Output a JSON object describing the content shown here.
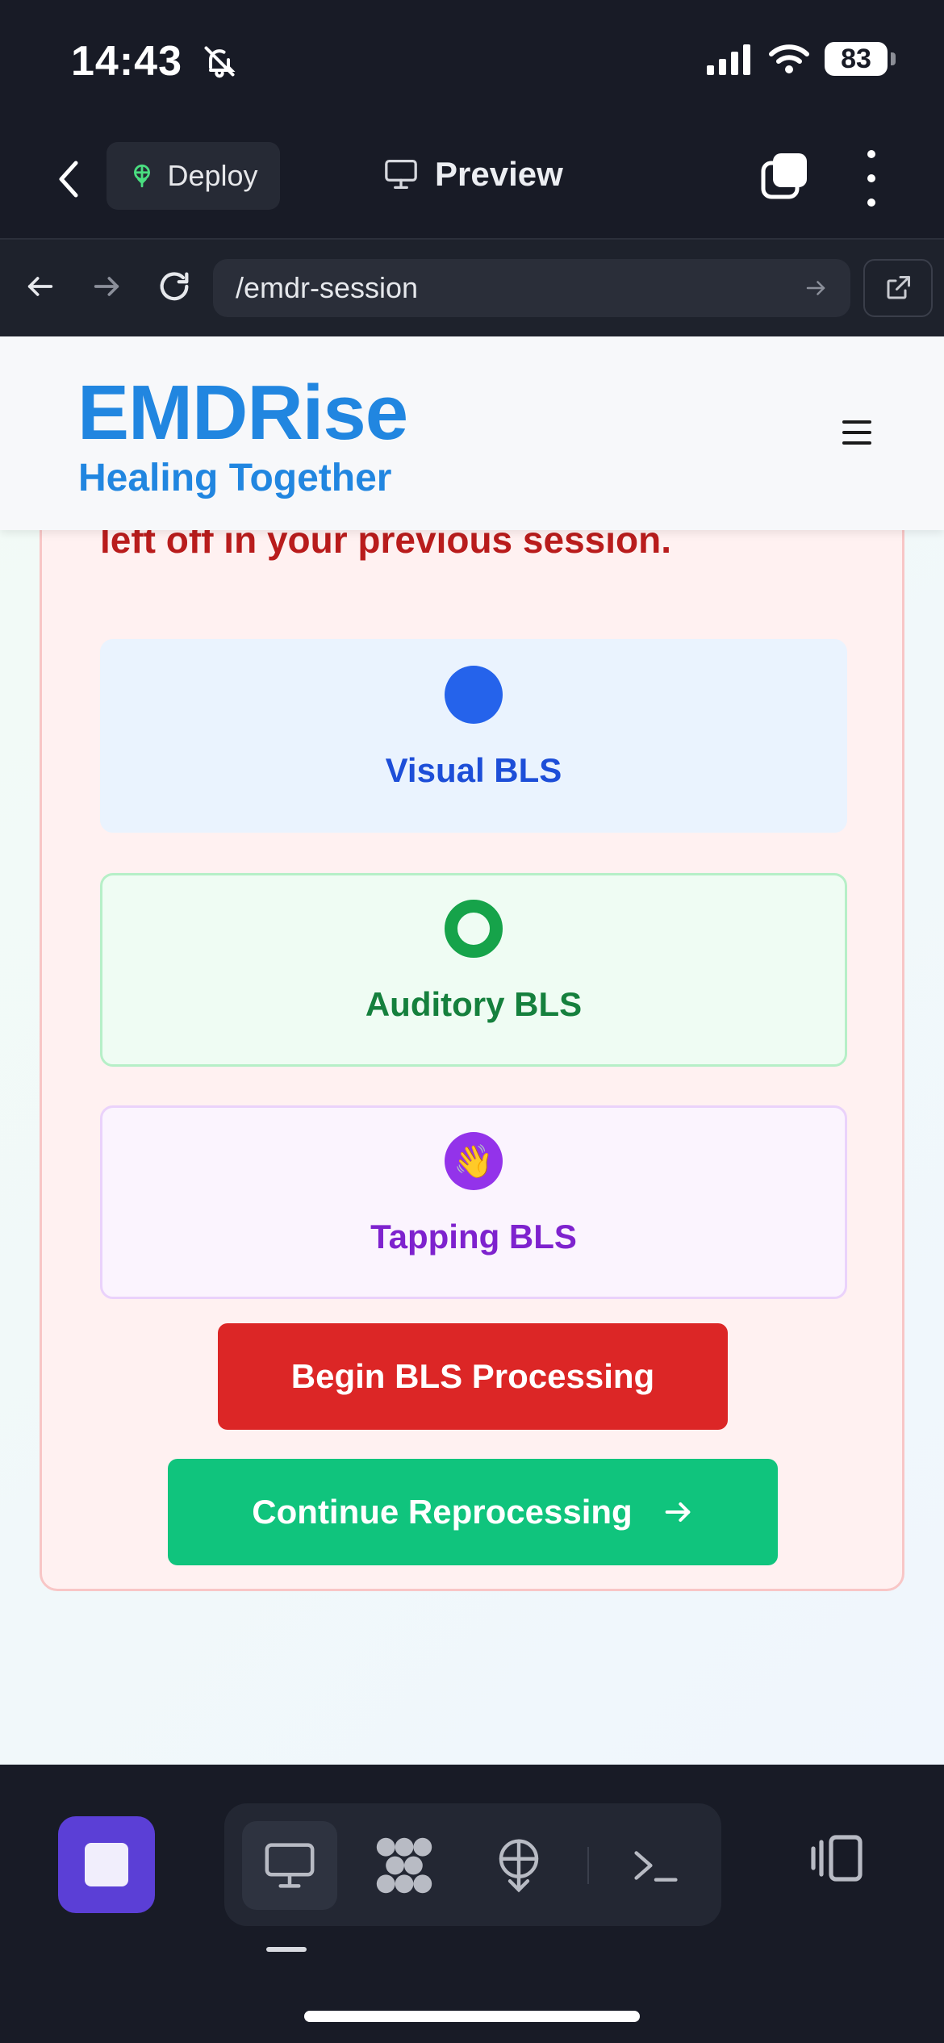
{
  "status_bar": {
    "time": "14:43",
    "battery": "83"
  },
  "toolbar": {
    "deploy_label": "Deploy",
    "preview_label": "Preview"
  },
  "browser": {
    "url": "/emdr-session"
  },
  "site": {
    "logo": "EMDRise",
    "tagline": "Healing Together"
  },
  "card": {
    "intro_text": "left off in your previous session.",
    "options": [
      {
        "label": "Visual BLS",
        "icon": "blue-dot-icon"
      },
      {
        "label": "Auditory BLS",
        "icon": "green-ring-icon"
      },
      {
        "label": "Tapping BLS",
        "icon": "waving-hand-icon",
        "emoji": "👋"
      }
    ],
    "begin_label": "Begin BLS Processing",
    "continue_label": "Continue Reprocessing",
    "continue_arrow": "→"
  },
  "colors": {
    "brand": "#2186e0",
    "danger": "#dc2626",
    "success": "#10c47d",
    "visual": "#2563eb",
    "auditory": "#16a34a",
    "tapping": "#9333ea",
    "dock_accent": "#5b3fd6"
  },
  "dock": {
    "tools": [
      "preview-monitor-icon",
      "workflow-icon",
      "deploy-icon",
      "terminal-icon"
    ],
    "active_tool": "preview-monitor-icon"
  }
}
